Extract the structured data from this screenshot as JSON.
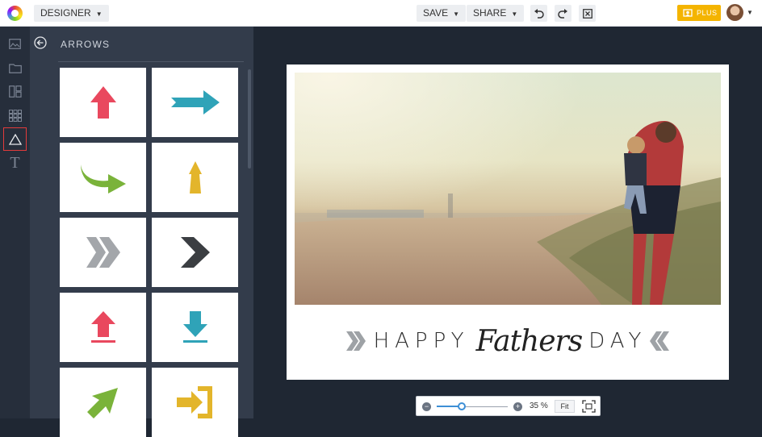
{
  "topbar": {
    "mode_label": "DESIGNER",
    "save_label": "SAVE",
    "share_label": "SHARE",
    "plus_label": "PLUS"
  },
  "rail": {
    "items": [
      "image-icon",
      "folder-icon",
      "layout-icon",
      "grid-icon",
      "shapes-icon",
      "text-icon"
    ],
    "text_glyph": "T",
    "active_index": 4
  },
  "panel": {
    "title": "ARROWS",
    "tiles": [
      {
        "icon": "arrow-up-icon",
        "color": "#e9485e"
      },
      {
        "icon": "arrow-right-icon",
        "color": "#2fa3b8"
      },
      {
        "icon": "curved-arrow-right-icon",
        "color": "#7ab33a"
      },
      {
        "icon": "arrow-up-narrow-icon",
        "color": "#e3b52b"
      },
      {
        "icon": "double-chevron-right-icon",
        "color": "#a3a6aa"
      },
      {
        "icon": "chevron-right-icon",
        "color": "#3b3e42"
      },
      {
        "icon": "upload-arrow-icon",
        "color": "#e9485e"
      },
      {
        "icon": "download-arrow-icon",
        "color": "#2fa3b8"
      },
      {
        "icon": "diagonal-arrow-icon",
        "color": "#7ab33a"
      },
      {
        "icon": "enter-arrow-icon",
        "color": "#e3b52b"
      }
    ]
  },
  "design": {
    "caption_left": "HAPPY",
    "caption_script": "Fathers",
    "caption_right": "DAY"
  },
  "zoom": {
    "percent_label": "35 %",
    "fit_label": "Fit",
    "value": 0.35
  },
  "colors": {
    "accent": "#f4b400",
    "active_outline": "#e33b3b",
    "slider": "#3d8fd6"
  }
}
